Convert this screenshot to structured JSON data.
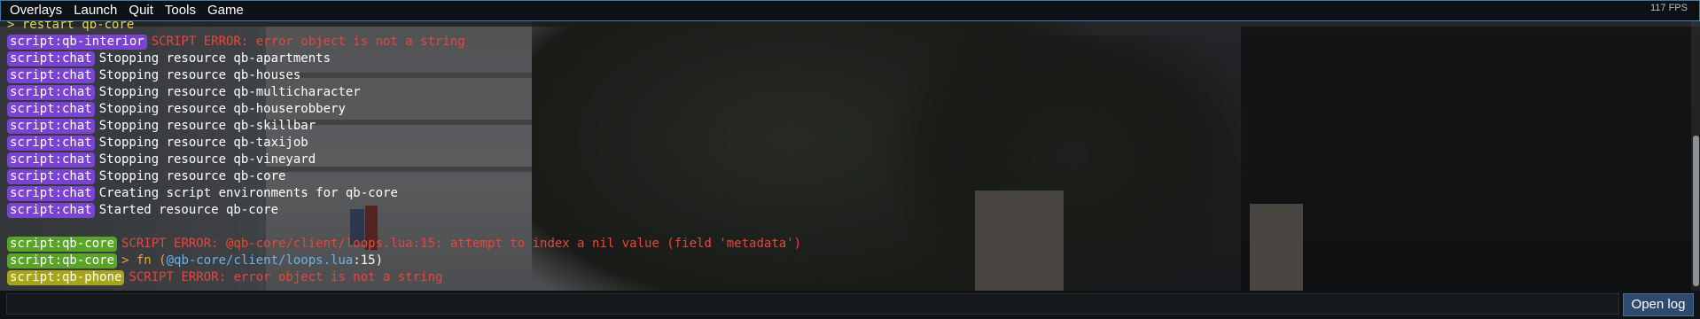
{
  "menubar": {
    "items": [
      "Overlays",
      "Launch",
      "Quit",
      "Tools",
      "Game"
    ],
    "fps": "117 FPS"
  },
  "console": {
    "top_line": "> restart qb-core",
    "lines": [
      {
        "tag": "script:qb-interior",
        "tag_color": "purple",
        "parts": [
          {
            "text": "SCRIPT ERROR: error object is not a string",
            "style": "red"
          }
        ]
      },
      {
        "tag": "script:chat",
        "tag_color": "purple",
        "parts": [
          {
            "text": "Stopping resource qb-apartments",
            "style": "white"
          }
        ]
      },
      {
        "tag": "script:chat",
        "tag_color": "purple",
        "parts": [
          {
            "text": "Stopping resource qb-houses",
            "style": "white"
          }
        ]
      },
      {
        "tag": "script:chat",
        "tag_color": "purple",
        "parts": [
          {
            "text": "Stopping resource qb-multicharacter",
            "style": "white"
          }
        ]
      },
      {
        "tag": "script:chat",
        "tag_color": "purple",
        "parts": [
          {
            "text": "Stopping resource qb-houserobbery",
            "style": "white"
          }
        ]
      },
      {
        "tag": "script:chat",
        "tag_color": "purple",
        "parts": [
          {
            "text": "Stopping resource qb-skillbar",
            "style": "white"
          }
        ]
      },
      {
        "tag": "script:chat",
        "tag_color": "purple",
        "parts": [
          {
            "text": "Stopping resource qb-taxijob",
            "style": "white"
          }
        ]
      },
      {
        "tag": "script:chat",
        "tag_color": "purple",
        "parts": [
          {
            "text": "Stopping resource qb-vineyard",
            "style": "white"
          }
        ]
      },
      {
        "tag": "script:chat",
        "tag_color": "purple",
        "parts": [
          {
            "text": "Stopping resource qb-core",
            "style": "white"
          }
        ]
      },
      {
        "tag": "script:chat",
        "tag_color": "purple",
        "parts": [
          {
            "text": "Creating script environments for qb-core",
            "style": "white"
          }
        ]
      },
      {
        "tag": "script:chat",
        "tag_color": "purple",
        "parts": [
          {
            "text": "Started resource qb-core",
            "style": "white"
          }
        ]
      },
      {
        "gap": true
      },
      {
        "tag": "script:qb-core",
        "tag_color": "green",
        "parts": [
          {
            "text": "SCRIPT ERROR: @qb-core/client/loops.lua:15: attempt to index a nil value (field 'metadata')",
            "style": "red"
          }
        ]
      },
      {
        "tag": "script:qb-core",
        "tag_color": "green",
        "parts": [
          {
            "text": "> fn (",
            "style": "orange"
          },
          {
            "text": "@qb-core/client/loops.lua",
            "style": "blue"
          },
          {
            "text": ":15)",
            "style": "white"
          }
        ]
      },
      {
        "tag": "script:qb-phone",
        "tag_color": "yellow",
        "parts": [
          {
            "text": "SCRIPT ERROR: error object is not a string",
            "style": "red"
          }
        ]
      }
    ]
  },
  "input": {
    "value": "",
    "placeholder": ""
  },
  "open_log_label": "Open log",
  "colors": {
    "tag_purple": "#7b43d2",
    "tag_green": "#59a52a",
    "tag_yellow": "#a6a519",
    "error_red": "#e8463c",
    "menubar_border": "#3b7bb3",
    "button_bg": "#2f4a6f"
  }
}
